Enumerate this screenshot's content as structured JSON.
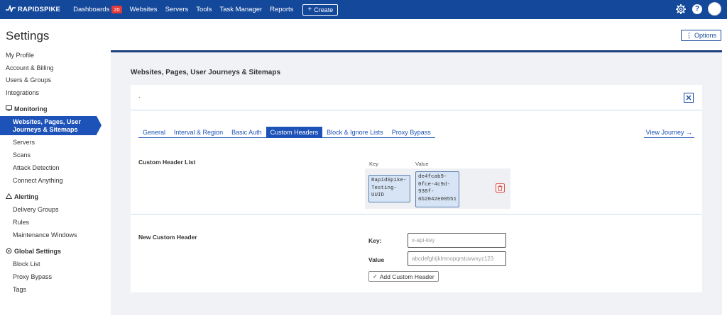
{
  "brand": {
    "name": "RAPIDSPIKE"
  },
  "nav": {
    "dashboards": {
      "label": "Dashboards",
      "count": "20"
    },
    "websites": "Websites",
    "servers": "Servers",
    "tools": "Tools",
    "task_manager": "Task Manager",
    "reports": "Reports",
    "create": "Create"
  },
  "header": {
    "help": "?"
  },
  "page": {
    "title": "Settings",
    "options_label": "Options"
  },
  "sidebar": {
    "top_links": [
      "My Profile",
      "Account & Billing",
      "Users & Groups",
      "Integrations"
    ],
    "monitoring": {
      "title": "Monitoring",
      "active": "Websites, Pages, User Journeys & Sitemaps",
      "items": [
        "Servers",
        "Scans",
        "Attack Detection",
        "Connect Anything"
      ]
    },
    "alerting": {
      "title": "Alerting",
      "items": [
        "Delivery Groups",
        "Rules",
        "Maintenance Windows"
      ]
    },
    "global": {
      "title": "Global Settings",
      "items": [
        "Block List",
        "Proxy Bypass",
        "Tags"
      ]
    }
  },
  "main": {
    "heading": "Websites, Pages, User Journeys & Sitemaps",
    "card_dot": ".",
    "tabs": [
      "General",
      "Interval & Region",
      "Basic Auth",
      "Custom Headers",
      "Block & Ignore Lists",
      "Proxy Bypass"
    ],
    "active_tab": "Custom Headers",
    "view_journey": "View Journey →",
    "custom_header_list": {
      "title": "Custom Header List",
      "key_heading": "Key",
      "value_heading": "Value",
      "rows": [
        {
          "key": "RapidSpike-Testing-UUID",
          "value": "de4fcab9-0fce-4c9d-938f-6b2042e00551"
        }
      ]
    },
    "new_header": {
      "title": "New Custom Header",
      "key_label": "Key:",
      "key_placeholder": "x-api-key",
      "value_label": "Value",
      "value_placeholder": "abcdefghijklmnopqrstuvwxyz123",
      "add_button": "Add Custom Header"
    }
  },
  "colors": {
    "navbar": "#14489b",
    "accent": "#1d52b8",
    "danger": "#d9534f"
  }
}
